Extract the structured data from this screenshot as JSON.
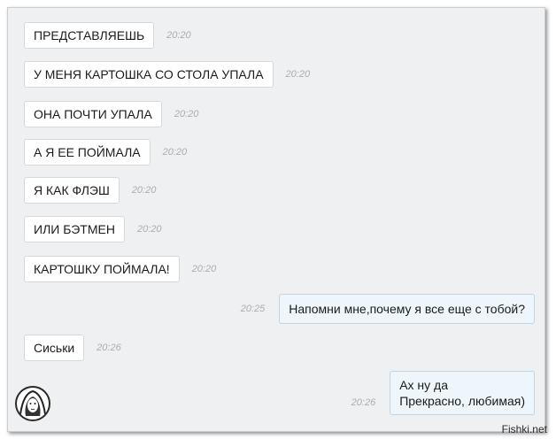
{
  "messages": [
    {
      "text": "ПРЕДСТАВЛЯЕШЬ",
      "time": "20:20",
      "side": "in"
    },
    {
      "text": "У МЕНЯ КАРТОШКА СО СТОЛА УПАЛА",
      "time": "20:20",
      "side": "in"
    },
    {
      "text": "ОНА ПОЧТИ УПАЛА",
      "time": "20:20",
      "side": "in"
    },
    {
      "text": "А Я ЕЕ ПОЙМАЛА",
      "time": "20:20",
      "side": "in"
    },
    {
      "text": "Я КАК ФЛЭШ",
      "time": "20:20",
      "side": "in"
    },
    {
      "text": "ИЛИ БЭТМЕН",
      "time": "20:20",
      "side": "in"
    },
    {
      "text": "КАРТОШКУ ПОЙМАЛА!",
      "time": "20:20",
      "side": "in"
    },
    {
      "text": "Напомни мне,почему я все еще с тобой?",
      "time": "20:25",
      "side": "out"
    },
    {
      "text": "Сиськи",
      "time": "20:26",
      "side": "in"
    },
    {
      "text_line1": "Ах ну да",
      "text_line2": "Прекрасно, любимая)",
      "time": "20:26",
      "side": "out"
    }
  ],
  "watermark": "Fishki.net",
  "colors": {
    "incoming_bg": "#ffffff",
    "outgoing_bg": "#eef6fb",
    "chat_bg": "#eef0f2",
    "time_text": "#a9aeb3"
  }
}
